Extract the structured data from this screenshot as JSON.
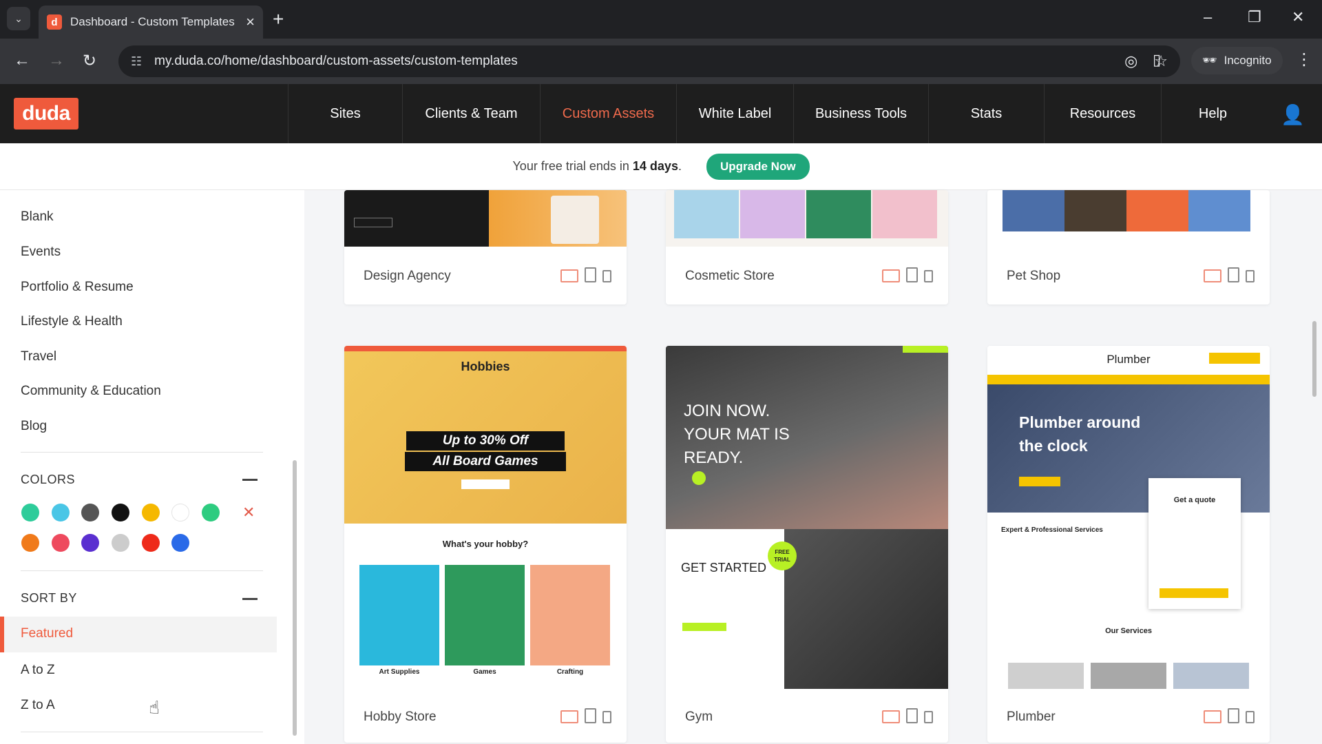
{
  "browser": {
    "tab_title": "Dashboard - Custom Templates",
    "url": "my.duda.co/home/dashboard/custom-assets/custom-templates",
    "incognito_label": "Incognito"
  },
  "app": {
    "logo": "duda",
    "nav": [
      {
        "label": "Sites"
      },
      {
        "label": "Clients & Team"
      },
      {
        "label": "Custom Assets"
      },
      {
        "label": "White Label"
      },
      {
        "label": "Business Tools"
      },
      {
        "label": "Stats"
      },
      {
        "label": "Resources"
      },
      {
        "label": "Help"
      }
    ],
    "active_nav": "Custom Assets"
  },
  "trial": {
    "text_prefix": "Your free trial ends in",
    "days": "14 days",
    "text_suffix": ".",
    "upgrade_label": "Upgrade Now"
  },
  "sidebar": {
    "categories": [
      "Blank",
      "Events",
      "Portfolio & Resume",
      "Lifestyle & Health",
      "Travel",
      "Community & Education",
      "Blog"
    ],
    "colors_heading": "COLORS",
    "colors": [
      "#2ecc9a",
      "#4ac6e6",
      "#555555",
      "#111111",
      "#f5b800",
      "#ffffff",
      "#2ecc80",
      "#f07a1a",
      "#ee4a5e",
      "#5a2fd0",
      "#cccccc",
      "#ee2a1a",
      "#2a6ae8"
    ],
    "sort_heading": "SORT BY",
    "sort_options": [
      "Featured",
      "A to Z",
      "Z to A"
    ]
  },
  "templates": [
    {
      "name": "Design Agency"
    },
    {
      "name": "Cosmetic Store"
    },
    {
      "name": "Pet Shop"
    },
    {
      "name": "Hobby Store",
      "thumb": {
        "header": "Hobbies",
        "promo1": "Up to 30% Off",
        "promo2": "All Board Games",
        "section": "What's your hobby?",
        "cats": [
          "Art Supplies",
          "Games",
          "Crafting"
        ]
      }
    },
    {
      "name": "Gym",
      "thumb": {
        "hero": "JOIN NOW. YOUR MAT IS READY.",
        "cta": "GET STARTED",
        "badge": "FREE TRIAL"
      }
    },
    {
      "name": "Plumber",
      "thumb": {
        "header": "Plumber",
        "hero": "Plumber around the clock",
        "quote": "Get a quote",
        "services": "Expert & Professional Services",
        "our": "Our Services"
      }
    }
  ]
}
